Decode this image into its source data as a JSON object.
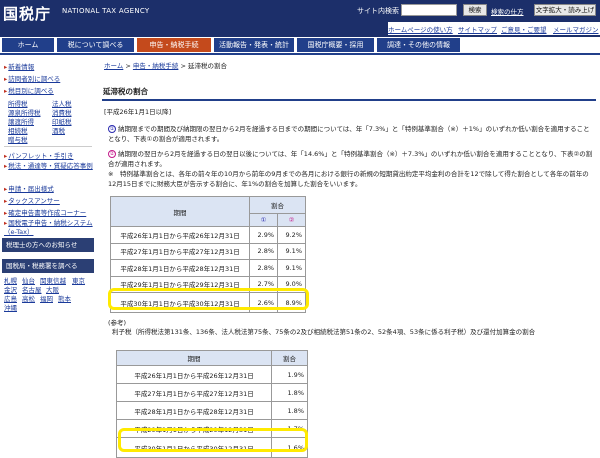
{
  "header": {
    "logo": "国税庁",
    "agency": "NATIONAL TAX AGENCY",
    "search_label": "サイト内検索",
    "search_placeholder": "",
    "search_button": "検索",
    "search_help": "検索の仕方",
    "text_size_button": "文字拡大・読み上げ",
    "utility_links": [
      "ホームページの使い方",
      "サイトマップ",
      "ご意見・ご要望",
      "メールマガジン"
    ]
  },
  "gnav": [
    {
      "label": "ホーム"
    },
    {
      "label": "税について調べる"
    },
    {
      "label": "申告・納税手続"
    },
    {
      "label": "活動報告・発表・統計"
    },
    {
      "label": "国税庁概要・採用"
    },
    {
      "label": "調達・その他の情報"
    }
  ],
  "sidebar": {
    "links": [
      "新着情報",
      "訪問者別に調べる",
      "税目別に調べる"
    ],
    "tax_items": [
      "所得税",
      "法人税",
      "源泉所得税",
      "消費税",
      "譲渡所得",
      "印紙税",
      "相続税",
      "酒税",
      "贈与税"
    ],
    "links2": [
      "パンフレット・手引き",
      "税法・通達等・質疑応答事例",
      "申請・届出様式",
      "タックスアンサー",
      "確定申告書等作成コーナー",
      "国税電子申告・納税システム（e-Tax）"
    ],
    "box1": "税理士の方へのお知らせ",
    "box2": "国税局・税務署を調べる",
    "offices": [
      "札幌",
      "仙台",
      "関東信越",
      "東京",
      "金沢",
      "名古屋",
      "大阪",
      "広島",
      "高松",
      "福岡",
      "熊本",
      "沖縄"
    ]
  },
  "main": {
    "breadcrumb": [
      "ホーム",
      "申告・納税手続",
      "延滞税の割合"
    ],
    "page_title": "延滞税の割合",
    "period_label": "[平成26年1月1日以降]",
    "note1_marker": "①",
    "note1": "納期限までの期間及び納期限の翌日から2月を経過する日までの期間については、年「7.3%」と「特例基準割合（※）＋1%」のいずれか低い割合を適用することとなり、下表①の割合が適用されます。",
    "note2_marker": "②",
    "note2": "納期限の翌日から2月を経過する日の翌日以後については、年「14.6%」と「特例基準割合（※）＋7.3%」のいずれか低い割合を適用することとなり、下表②の割合が適用されます。",
    "note3": "※　特例基準割合とは、各年の前々年の10月から前年の9月までの各月における銀行の新規の短期貸出約定平均金利の合計を12で除して得た割合として各年の前年の12月15日までに財務大臣が告示する割合に、年1%の割合を加算した割合をいいます。",
    "table1": {
      "col_period": "期間",
      "col_rate": "割合",
      "col_1": "①",
      "col_2": "②",
      "rows": [
        {
          "period": "平成26年1月1日から平成26年12月31日",
          "r1": "2.9%",
          "r2": "9.2%"
        },
        {
          "period": "平成27年1月1日から平成27年12月31日",
          "r1": "2.8%",
          "r2": "9.1%"
        },
        {
          "period": "平成28年1月1日から平成28年12月31日",
          "r1": "2.8%",
          "r2": "9.1%"
        },
        {
          "period": "平成29年1月1日から平成29年12月31日",
          "r1": "2.7%",
          "r2": "9.0%"
        },
        {
          "period": "平成30年1月1日から平成30年12月31日",
          "r1": "2.6%",
          "r2": "8.9%"
        }
      ]
    },
    "reference_label": "(参考)",
    "reference_text": "利子税（所得税法第131条、136条、法人税法第75条、75条の2及び相続税法第51条の2、52条4項、53条に係る利子税）及び還付加算金の割合",
    "table2": {
      "col_period": "期間",
      "col_rate": "割合",
      "rows": [
        {
          "period": "平成26年1月1日から平成26年12月31日",
          "rate": "1.9%"
        },
        {
          "period": "平成27年1月1日から平成27年12月31日",
          "rate": "1.8%"
        },
        {
          "period": "平成28年1月1日から平成28年12月31日",
          "rate": "1.8%"
        },
        {
          "period": "平成29年1月1日から平成29年12月31日",
          "rate": "1.7%"
        },
        {
          "period": "平成30年1月1日から平成30年12月31日",
          "rate": "1.6%"
        }
      ]
    }
  },
  "colors": {
    "header_bg": "#1c2f6a",
    "nav_bg": "#213f8a",
    "nav_active": "#c44a1c",
    "link": "#1a3a9a",
    "highlight": "#ffea00"
  }
}
